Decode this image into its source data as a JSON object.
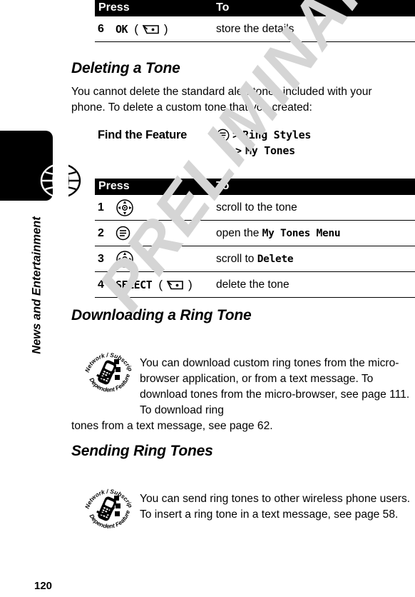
{
  "watermark": {
    "text": "PRELIMINARY"
  },
  "sidebar": {
    "tab_label": "News and Entertainment",
    "tab_icon": "globe-icon"
  },
  "footer": {
    "page_number": "120"
  },
  "top_table": {
    "headers": {
      "press": "Press",
      "to": "To"
    },
    "rows": [
      {
        "num": "6",
        "press_label": "OK",
        "press_key": "softkey-right-icon",
        "to": "store the details"
      }
    ]
  },
  "sections": [
    {
      "heading": "Deleting a Tone",
      "paragraph": "You cannot delete the standard alert tones included with your phone. To delete a custom tone that you created:"
    },
    {
      "heading": "Downloading a Ring Tone",
      "badge": "network-subscription-dependent-feature-icon",
      "paragraph": "You can download custom ring tones from the micro-browser application, or from a text message. To download tones from the micro-browser, see page 111. To download ring tones from a text message, see page 62."
    },
    {
      "heading": "Sending Ring Tones",
      "badge": "network-subscription-dependent-feature-icon",
      "paragraph": "You can send ring tones to other wireless phone users. To insert a ring tone in a text message, see page 58."
    }
  ],
  "find_the_feature": {
    "label": "Find the Feature",
    "key_icon": "menu-key-icon",
    "separator": ">",
    "path": [
      "Ring Styles",
      "My Tones"
    ]
  },
  "steps_table": {
    "headers": {
      "press": "Press",
      "to": "To"
    },
    "rows": [
      {
        "num": "1",
        "press_icon": "navigation-key-icon",
        "press_label": "",
        "to_prefix": "scroll to the tone",
        "to_mono": ""
      },
      {
        "num": "2",
        "press_icon": "menu-key-icon",
        "press_label": "",
        "to_prefix": "open the ",
        "to_mono": "My Tones Menu"
      },
      {
        "num": "3",
        "press_icon": "navigation-key-icon",
        "press_label": "",
        "to_prefix": "scroll to ",
        "to_mono": "Delete"
      },
      {
        "num": "4",
        "press_icon": "softkey-right-icon",
        "press_label": "SELECT",
        "to_prefix": "delete the tone",
        "to_mono": ""
      }
    ]
  },
  "badge_text": {
    "top": "Network / Subscription",
    "bottom": "Dependent Feature"
  },
  "colors": {
    "header_bg": "#000000",
    "header_fg": "#ffffff",
    "watermark": "#d5d5d5",
    "text": "#000000"
  }
}
